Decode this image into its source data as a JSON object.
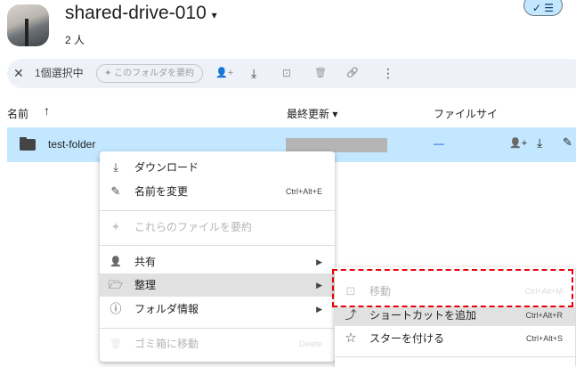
{
  "drive": {
    "title": "shared-drive-010",
    "dropdown_icon": "▾",
    "members": "2 人",
    "view_toggle": "✓ ☰"
  },
  "toolbar": {
    "close": "✕",
    "selected": "1個選択中",
    "summarize": "✦ このフォルダを要約",
    "icons": {
      "share": "👤+",
      "download": "⤓",
      "move": "⊡",
      "trash": "🗑",
      "link": "🔗",
      "more": "⋮"
    }
  },
  "columns": {
    "name": "名前",
    "sort": "↑",
    "modified": "最終更新 ▾",
    "size": "ファイルサイ"
  },
  "row": {
    "name": "test-folder",
    "size": "—"
  },
  "menu": {
    "items": [
      {
        "icon": "⤓",
        "label": "ダウンロード",
        "shortcut": ""
      },
      {
        "icon": "✎",
        "label": "名前を変更",
        "shortcut": "Ctrl+Alt+E"
      },
      {
        "icon": "✦",
        "label": "これらのファイルを要約",
        "shortcut": ""
      },
      {
        "icon": "👤",
        "label": "共有",
        "arrow": "▶"
      },
      {
        "icon": "🗁",
        "label": "整理",
        "arrow": "▶"
      },
      {
        "icon": "ⓘ",
        "label": "フォルダ情報",
        "arrow": "▶"
      },
      {
        "icon": "🗑",
        "label": "ゴミ箱に移動",
        "shortcut": "Delete"
      }
    ]
  },
  "submenu": {
    "items": [
      {
        "icon": "⊡",
        "label": "移動",
        "shortcut": "Ctrl+Alt+M"
      },
      {
        "icon": "⤴",
        "label": "ショートカットを追加",
        "shortcut": "Ctrl+Alt+R"
      },
      {
        "icon": "☆",
        "label": "スターを付ける",
        "shortcut": "Ctrl+Alt+S"
      }
    ]
  }
}
